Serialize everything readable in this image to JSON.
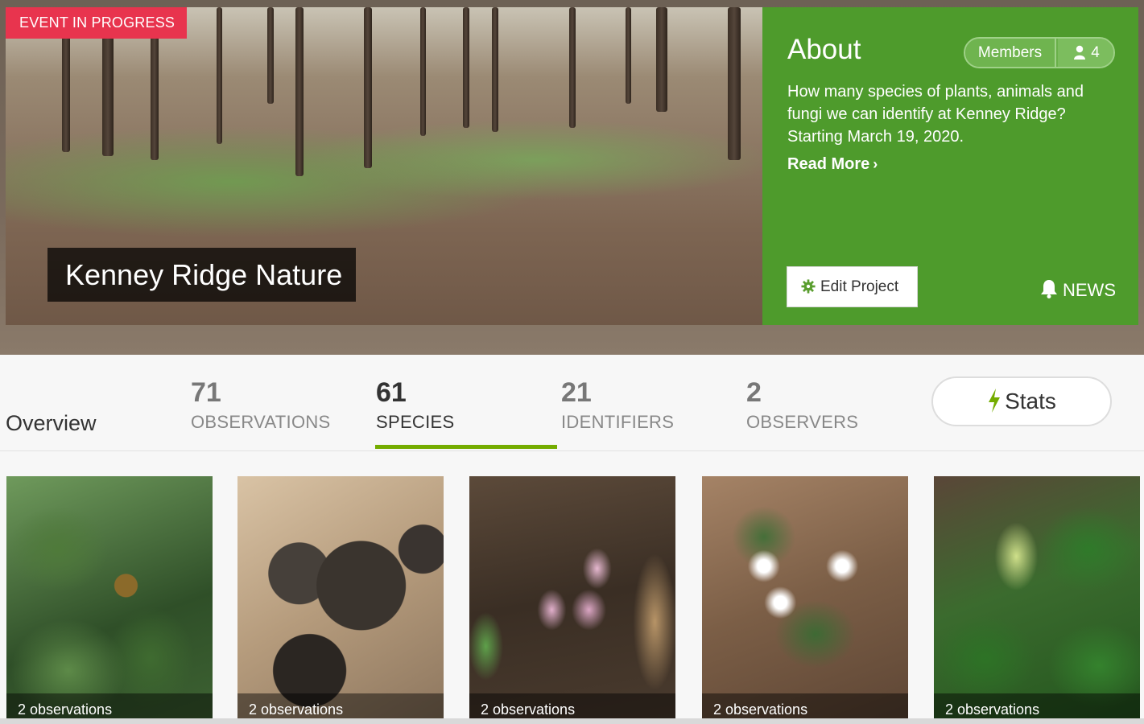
{
  "hero": {
    "event_badge": "EVENT IN PROGRESS",
    "project_title": "Kenney Ridge Nature"
  },
  "about": {
    "title": "About",
    "members_label": "Members",
    "members_count": "4",
    "description": "How many species of plants, animals and fungi we can identify at Kenney Ridge? Starting March 19, 2020.",
    "read_more": "Read More",
    "edit_project": "Edit Project",
    "news": "NEWS",
    "bg_color": "#4e9b2c"
  },
  "stats": {
    "overview": "Overview",
    "items": [
      {
        "num": "71",
        "label": "OBSERVATIONS"
      },
      {
        "num": "61",
        "label": "SPECIES"
      },
      {
        "num": "21",
        "label": "IDENTIFIERS"
      },
      {
        "num": "2",
        "label": "OBSERVERS"
      }
    ],
    "active_tab": "SPECIES",
    "stats_button": "Stats",
    "accent_color": "#74ac00"
  },
  "species": [
    {
      "caption": "2 observations",
      "subject": "beech leaves with burr"
    },
    {
      "caption": "2 observations",
      "subject": "black cup fungi"
    },
    {
      "caption": "2 observations",
      "subject": "pink pinesap flowers"
    },
    {
      "caption": "2 observations",
      "subject": "white star chickweed flowers"
    },
    {
      "caption": "2 observations",
      "subject": "green flowering plant"
    }
  ]
}
